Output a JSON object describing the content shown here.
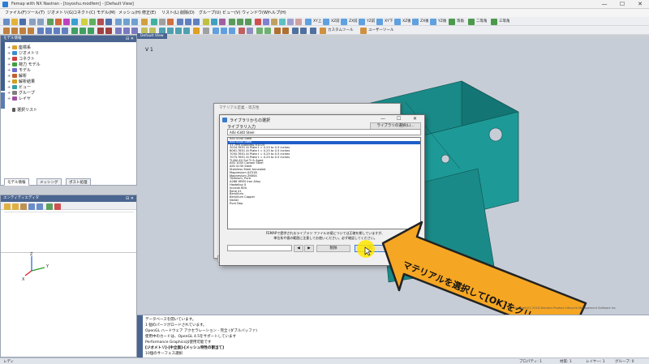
{
  "window": {
    "title": "Femap with NX Nastran - [toyoshu.modfem] - [Default View]",
    "controls": [
      "—",
      "☐",
      "✕"
    ]
  },
  "menu": [
    "ファイル(F)",
    "ツール(T)",
    "ジオメトリ(G)",
    "コネクト(C)",
    "モデル(M)",
    "メッシュ(H)",
    "修正(E)",
    "リスト(L)",
    "削除(D)",
    "グループ(U)",
    "ビュー(V)",
    "ウィンドウ(W)",
    "ヘルプ(H)"
  ],
  "toolbar": {
    "view_buttons": [
      "XY上",
      "XZ前",
      "ZX前",
      "YZ前",
      "XY下",
      "XZ後",
      "ZX後",
      "YZ後",
      "等角",
      "二等角",
      "三等角"
    ],
    "custom_tools": "カスタムツール",
    "user_tools": "ユーザーツール"
  },
  "model_panel": {
    "title": "モデル情報",
    "items": [
      {
        "label": "座標系",
        "color": "#d9a030"
      },
      {
        "label": "ジオメトリ",
        "color": "#3a8fd0"
      },
      {
        "label": "コネクト",
        "color": "#d04040"
      },
      {
        "label": "荷力 モデル",
        "color": "#40a040"
      },
      {
        "label": "モデル",
        "color": "#6a6ad0"
      },
      {
        "label": "解析",
        "color": "#c06030"
      },
      {
        "label": "解析結果",
        "color": "#d0a020"
      },
      {
        "label": "ビュー",
        "color": "#30a0a0"
      },
      {
        "label": "グループ",
        "color": "#808080"
      },
      {
        "label": "レイヤ",
        "color": "#a050a0"
      }
    ],
    "selection_list": "選択リスト",
    "tabs": [
      "モデル情報",
      "メッシング",
      "ポスト処理"
    ]
  },
  "entity_panel": {
    "title": "エンティティエディタ"
  },
  "viewport": {
    "tab": "Default View",
    "label": "V 1"
  },
  "back_dialog": {
    "title": "マテリアル定義 - 等方性",
    "id_label": "ID"
  },
  "lib_dialog": {
    "title": "ライブラリからの選択",
    "input_label": "ライブラリ入力",
    "choose_library_button": "ライブラリの選択(L)...",
    "input_value": "AISI 4340 Steel",
    "items": [
      "AISI 4340 Steel",
      "17-7PH Stainless H1025",
      "2024-T851 Al Plate t = 0.25 to 0.5 inches",
      "6061-T651 Al Plate t = 0.25 to 0.5 inches",
      "7050-T651 Al Plate t = 0.25 to 0.5 inches",
      "7075-T651 Al Plate t = 0.25 to 0.5 inches",
      "Ti-6Al-4V Sol Tr & Aged",
      "AISI 1005 Carbon Steel",
      "AISI 4130 Steel",
      "Stainless Steel Annealed",
      "Magnesium AZ31B",
      "Magnesium ZK60A",
      "Titanium, Pure",
      "A286 HRES Iron Alloy",
      "Hastelloy X",
      "Inconel 600",
      "Rene 41",
      "Beryllium",
      "Beryllium Copper",
      "Nickel",
      "Pure Dep"
    ],
    "selected_index": 1,
    "note_lines": [
      "FEMAPで提供されるライブラリ ファイルの値については正確を期していますが、",
      "単位系や値の範囲に注意してお使いください。必ず確認してください。"
    ],
    "delete_button": "削除",
    "ok_button": "OK",
    "cancel_button": "キャンセル"
  },
  "back_buttons": [
    "読込み(O)...",
    "保存(S)...",
    "コピー(Y)...",
    "OK",
    "キャンセル"
  ],
  "annotation": {
    "text": "マテリアルを選択して[OK]をクリック",
    "color": "#f5a623"
  },
  "messages": [
    {
      "text": "データベースを開いています。",
      "bold": false
    },
    {
      "text": "1 個のパーツがロードされています。",
      "bold": false
    },
    {
      "text": "OpenGL ハードウェア アクセラレーション - 完全 (ダブルバッファ)",
      "bold": false
    },
    {
      "text": "使用中のカードは、OpenGL 4.5をサポートしています",
      "bold": false
    },
    {
      "text": "Performance Graphicsは使用可能です",
      "bold": false
    },
    {
      "text": "[ジオメトリ]-[中立面]-[メッシュ特性の割当て]",
      "bold": true
    },
    {
      "text": "10個のサーフェス選択",
      "bold": false
    }
  ],
  "copyright": "Copyright(C) 2018 Siemens Product Lifecycle Management Software Inc.",
  "status": {
    "left": "レディ",
    "properties": "プロパティ: 1",
    "material": "材質: 1",
    "layer": "レイヤー: 1",
    "group": "グループ: 0"
  }
}
